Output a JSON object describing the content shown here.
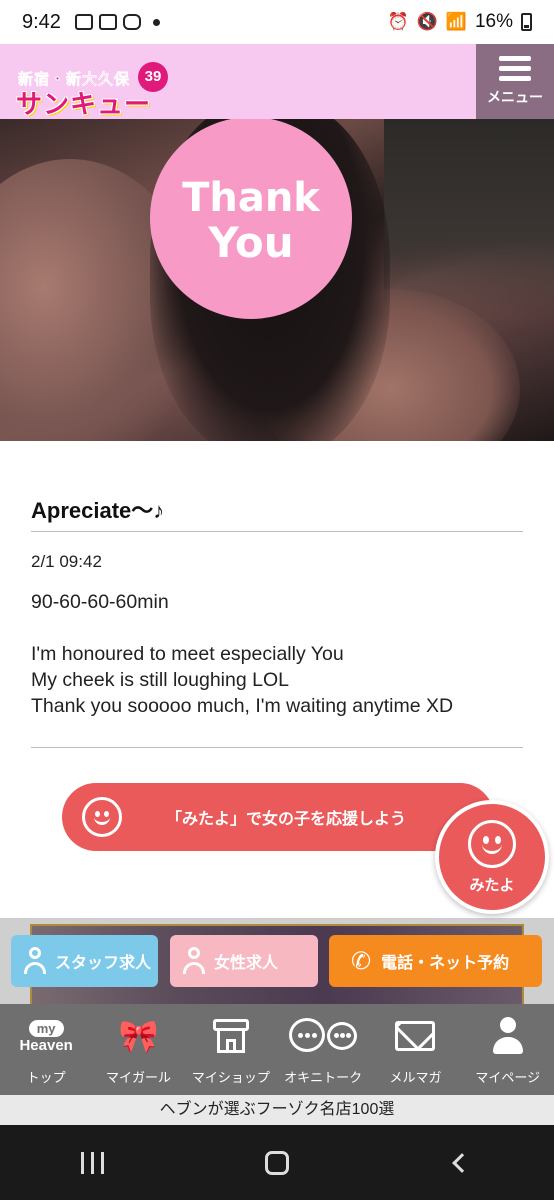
{
  "status_bar": {
    "time": "9:42",
    "battery": "16%"
  },
  "header": {
    "logo_line1": "新宿・新大久保",
    "logo_line2": "サンキュー",
    "logo_badge": "39",
    "menu_label": "メニュー"
  },
  "photo": {
    "thank_line1": "Thank",
    "thank_line2": "You"
  },
  "post": {
    "title": "Apreciate～♪",
    "date": "2/1 09:42",
    "body": [
      "90-60-60-60min",
      "",
      "I'm honoured to meet especially You",
      "My cheek is still loughing LOL",
      "Thank you sooooo much, I'm waiting anytime XD"
    ]
  },
  "cheer": {
    "bar_label": "「みたよ」で女の子を応援しよう",
    "fab_label": "みたよ"
  },
  "actions": {
    "staff": "スタッフ求人",
    "woman": "女性求人",
    "phone": "電話・ネット予約"
  },
  "tabs": [
    {
      "label": "トップ",
      "icon": "my-heaven-icon",
      "icon_my": "my",
      "icon_heaven": "Heaven"
    },
    {
      "label": "マイガール",
      "icon": "ribbon-icon"
    },
    {
      "label": "マイショップ",
      "icon": "shop-icon"
    },
    {
      "label": "オキニトーク",
      "icon": "chat-bubbles-icon"
    },
    {
      "label": "メルマガ",
      "icon": "mail-icon"
    },
    {
      "label": "マイページ",
      "icon": "user-icon"
    }
  ],
  "footer_strip": "ヘブンが選ぶフーゾク名店100選",
  "colors": {
    "header_bg": "#f7c8f0",
    "menu_bg": "#8a6d82",
    "cheer": "#ea5a5a",
    "staff": "#7dc9ea",
    "woman": "#f7b8c2",
    "phone": "#f58a1f",
    "tabbar": "#6f6f6f"
  }
}
